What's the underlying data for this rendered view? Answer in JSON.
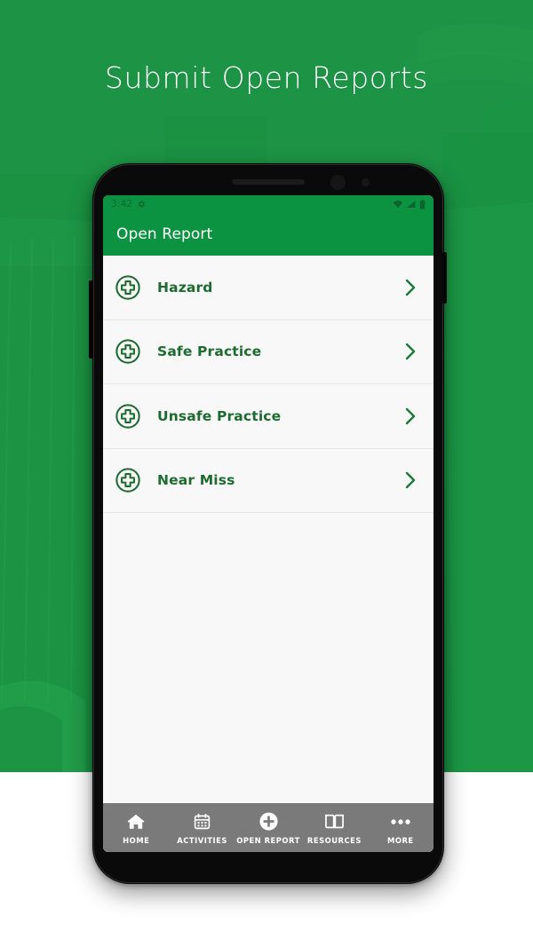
{
  "page": {
    "headline": "Submit Open Reports",
    "background_color": "#1d9445",
    "accent_color": "#0c9342",
    "list_text_color": "#1d6b2f"
  },
  "phone": {
    "status_bar": {
      "clock": "3:42",
      "notification_icon": "gear-icon",
      "system_icons": [
        "wifi-icon",
        "cellular-signal-icon",
        "battery-icon"
      ]
    },
    "app_bar": {
      "title": "Open Report"
    },
    "report_list": [
      {
        "icon": "plus-circle-icon",
        "label": "Hazard",
        "chevron": "chevron-right-icon"
      },
      {
        "icon": "plus-circle-icon",
        "label": "Safe Practice",
        "chevron": "chevron-right-icon"
      },
      {
        "icon": "plus-circle-icon",
        "label": "Unsafe Practice",
        "chevron": "chevron-right-icon"
      },
      {
        "icon": "plus-circle-icon",
        "label": "Near Miss",
        "chevron": "chevron-right-icon"
      }
    ],
    "bottom_nav": {
      "background_color": "#7a7a7a",
      "items": [
        {
          "icon": "home-icon",
          "label": "HOME"
        },
        {
          "icon": "calendar-icon",
          "label": "ACTIVITIES"
        },
        {
          "icon": "plus-circle-icon",
          "label": "OPEN REPORT"
        },
        {
          "icon": "book-icon",
          "label": "RESOURCES"
        },
        {
          "icon": "more-dots-icon",
          "label": "MORE"
        }
      ]
    }
  }
}
